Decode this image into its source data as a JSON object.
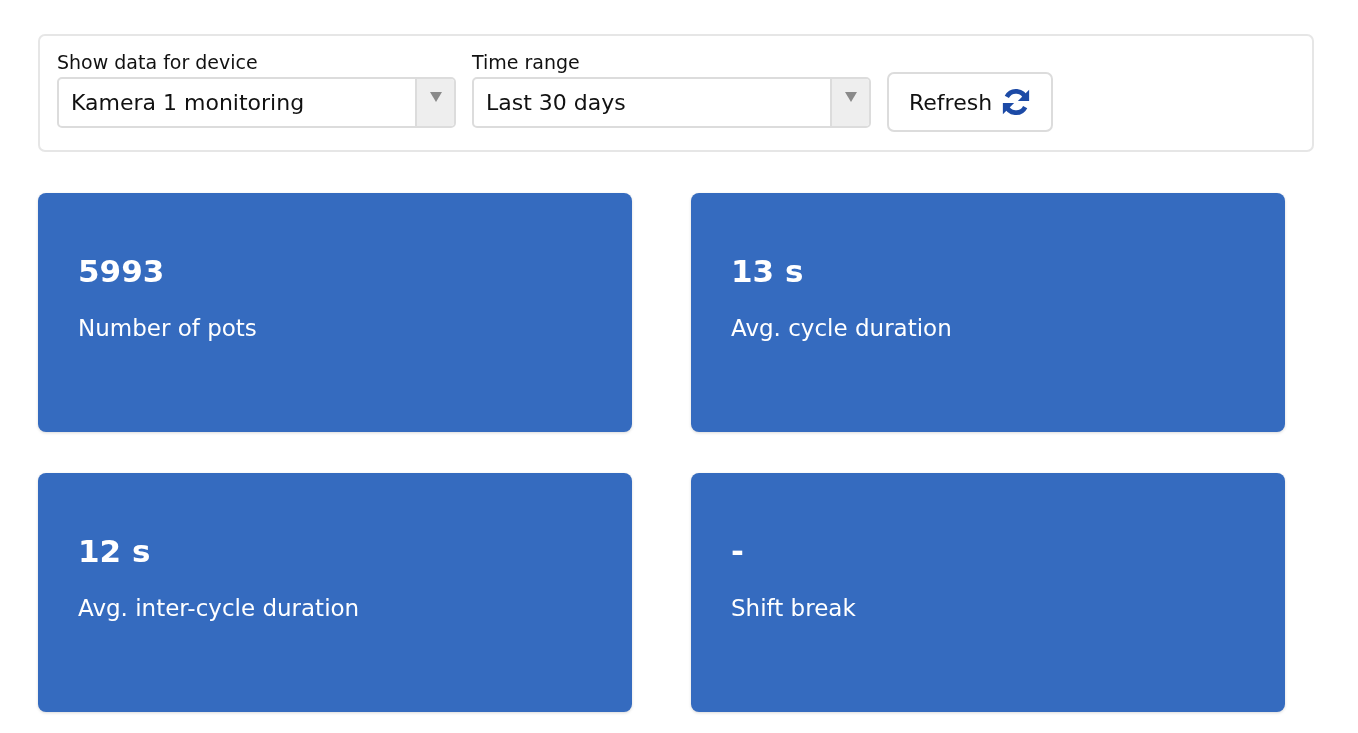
{
  "filter_panel": {
    "device_select": {
      "label": "Show data for device",
      "value": "Kamera 1 monitoring"
    },
    "time_range_select": {
      "label": "Time range",
      "value": "Last 30 days"
    },
    "refresh_button": {
      "label": "Refresh"
    }
  },
  "stat_cards": [
    {
      "value": "5993",
      "label": "Number of pots"
    },
    {
      "value": "13 s",
      "label": "Avg. cycle duration"
    },
    {
      "value": "12 s",
      "label": "Avg. inter-cycle duration"
    },
    {
      "value": "-",
      "label": "Shift break"
    }
  ]
}
